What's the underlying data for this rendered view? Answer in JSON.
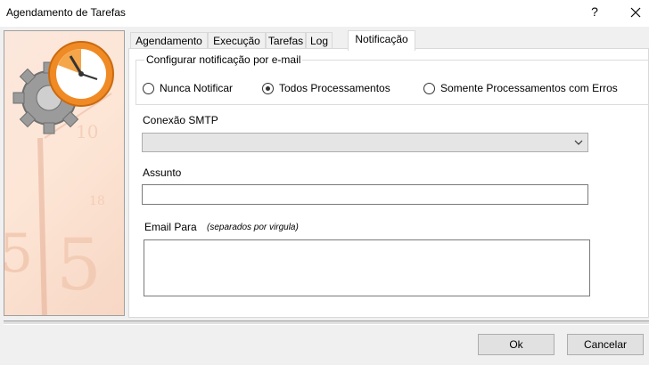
{
  "window": {
    "title": "Agendamento de Tarefas",
    "help_label": "?"
  },
  "tabs": [
    {
      "label": "Agendamento"
    },
    {
      "label": "Execução"
    },
    {
      "label": "Tarefas"
    },
    {
      "label": "Log"
    },
    {
      "label": "Notificação",
      "active": true
    }
  ],
  "notification": {
    "group_label": "Configurar notificação por e-mail",
    "options": [
      {
        "label": "Nunca Notificar",
        "checked": false
      },
      {
        "label": "Todos Processamentos",
        "checked": true
      },
      {
        "label": "Somente Processamentos com Erros",
        "checked": false
      }
    ],
    "smtp_label": "Conexão SMTP",
    "smtp_value": "",
    "subject_label": "Assunto",
    "subject_value": "",
    "email_to_label": "Email Para",
    "email_to_hint": "(separados por virgula)",
    "email_to_value": ""
  },
  "buttons": {
    "ok": "Ok",
    "cancel": "Cancelar"
  },
  "colors": {
    "clock_orange": "#f08a24",
    "gear_gray": "#8c8c8c",
    "panel_bg": "#f0f0f0"
  }
}
